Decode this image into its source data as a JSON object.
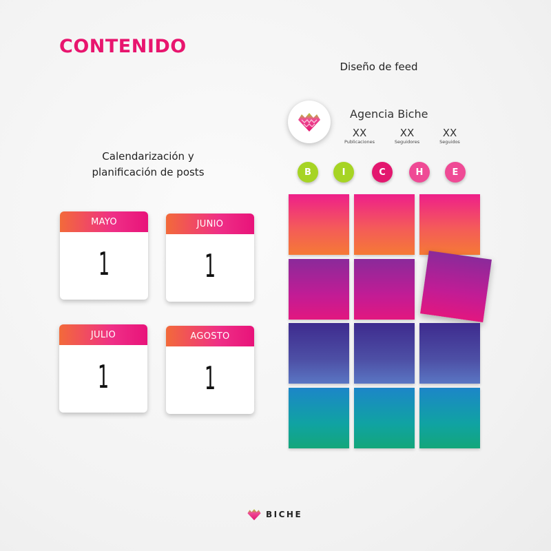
{
  "page": {
    "title": "CONTENIDO",
    "feed_heading": "Diseño de feed",
    "calendar_heading": [
      "Calendarización y",
      "planificación de posts"
    ]
  },
  "calendars": [
    {
      "month": "MAYO",
      "day": "1"
    },
    {
      "month": "JUNIO",
      "day": "1"
    },
    {
      "month": "JULIO",
      "day": "1"
    },
    {
      "month": "AGOSTO",
      "day": "1"
    }
  ],
  "profile": {
    "name": "Agencia Biche",
    "logo_icon": "biche-heart-logo",
    "stats": [
      {
        "value": "XX",
        "label": "Publicaciones"
      },
      {
        "value": "XX",
        "label": "Seguidores"
      },
      {
        "value": "XX",
        "label": "Seguidos"
      }
    ]
  },
  "highlights": [
    {
      "letter": "B",
      "color": "#a6d424"
    },
    {
      "letter": "I",
      "color": "#a6d424"
    },
    {
      "letter": "C",
      "color": "#e3176f"
    },
    {
      "letter": "H",
      "color": "#ef4a95"
    },
    {
      "letter": "E",
      "color": "#ef4a95"
    }
  ],
  "feed_grid": {
    "rows": [
      [
        "orange",
        "orange",
        "orange"
      ],
      [
        "purple",
        "purple",
        "purple-tilted"
      ],
      [
        "indigo",
        "indigo",
        "indigo"
      ],
      [
        "teal",
        "teal",
        "teal"
      ]
    ]
  },
  "footer": {
    "brand": "BICHE",
    "logo_icon": "biche-heart-logo"
  },
  "colors": {
    "accent": "#e8156e",
    "green": "#a6d424"
  }
}
